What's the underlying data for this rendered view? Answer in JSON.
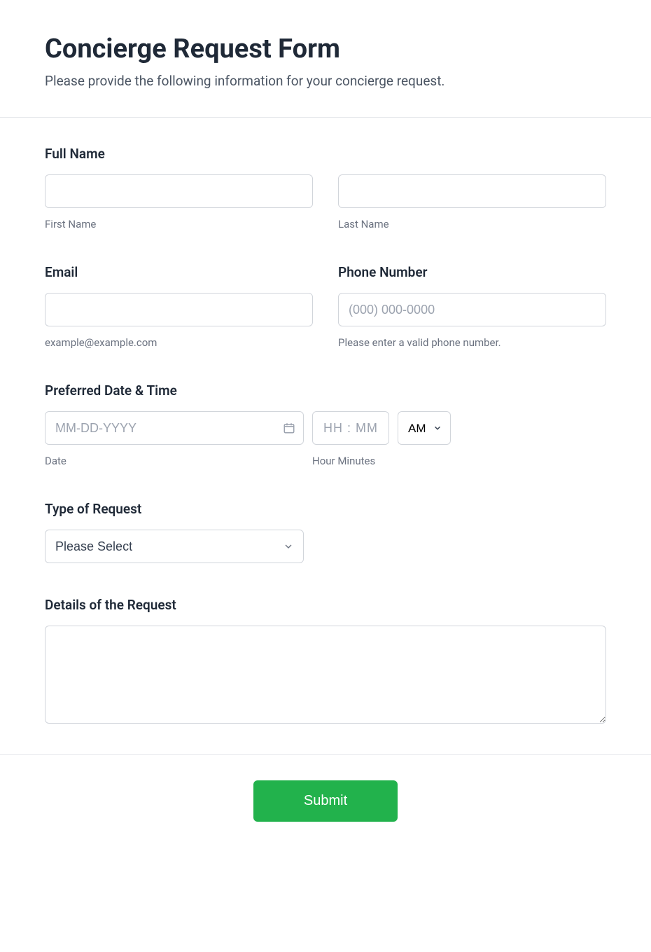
{
  "header": {
    "title": "Concierge Request Form",
    "subtitle": "Please provide the following information for your concierge request."
  },
  "fullName": {
    "label": "Full Name",
    "first": {
      "value": "",
      "sublabel": "First Name"
    },
    "last": {
      "value": "",
      "sublabel": "Last Name"
    }
  },
  "email": {
    "label": "Email",
    "value": "",
    "hint": "example@example.com"
  },
  "phone": {
    "label": "Phone Number",
    "placeholder": "(000) 000-0000",
    "value": "",
    "hint": "Please enter a valid phone number."
  },
  "datetime": {
    "label": "Preferred Date & Time",
    "date": {
      "placeholder": "MM-DD-YYYY",
      "value": "",
      "sublabel": "Date"
    },
    "time": {
      "placeholder": "HH : MM",
      "value": "",
      "sublabel": "Hour Minutes"
    },
    "ampm": {
      "value": "AM"
    }
  },
  "requestType": {
    "label": "Type of Request",
    "placeholder": "Please Select"
  },
  "details": {
    "label": "Details of the Request",
    "value": ""
  },
  "submit": {
    "label": "Submit"
  }
}
